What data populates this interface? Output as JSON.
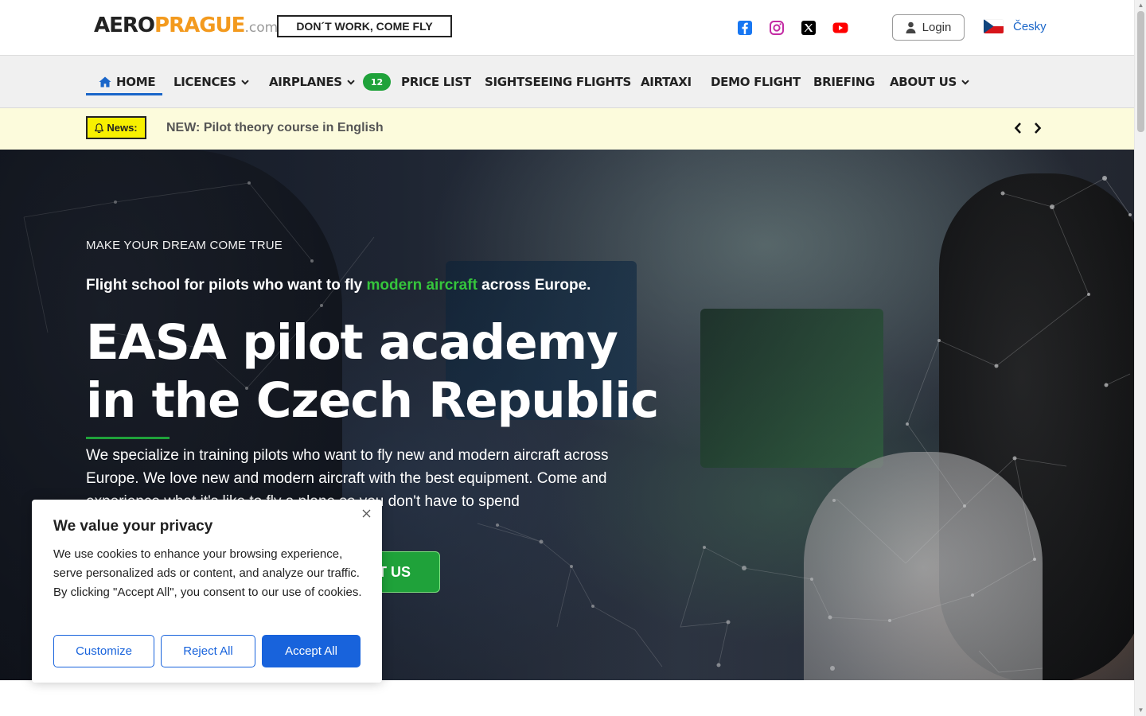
{
  "header": {
    "logo": {
      "part1": "AERO",
      "part2": "PRAGUE",
      "part3": ".com"
    },
    "slogan": "DON´T WORK, COME FLY",
    "social": [
      {
        "name": "facebook",
        "color": "#1877f2"
      },
      {
        "name": "instagram",
        "color": "#c32aa3"
      },
      {
        "name": "x",
        "color": "#000000"
      },
      {
        "name": "youtube",
        "color": "#ff0000"
      }
    ],
    "login_label": "Login",
    "language_label": "Česky"
  },
  "nav": {
    "items": [
      {
        "label": "HOME",
        "active": true
      },
      {
        "label": "LICENCES",
        "dropdown": true
      },
      {
        "label": "AIRPLANES",
        "dropdown": true,
        "badge": "12"
      },
      {
        "label": "PRICE LIST"
      },
      {
        "label": "SIGHTSEEING FLIGHTS"
      },
      {
        "label": "AIRTAXI"
      },
      {
        "label": "DEMO FLIGHT"
      },
      {
        "label": "BRIEFING"
      },
      {
        "label": "ABOUT US",
        "dropdown": true
      }
    ]
  },
  "news": {
    "label": "News:",
    "text": "NEW: Pilot theory course in English"
  },
  "hero": {
    "eyebrow": "MAKE YOUR DREAM COME TRUE",
    "lead_before": "Flight school for pilots who want to fly ",
    "lead_highlight": "modern aircraft",
    "lead_after": " across Europe.",
    "title": "EASA pilot academy in the Czech Republic",
    "description": "We specialize in training pilots who want to fly new and modern aircraft across Europe. We love new and modern aircraft with the best equipment. Come and experience what it's like to fly a plane so you don't have to spend",
    "cta_label": "T US"
  },
  "cookie": {
    "title": "We value your privacy",
    "text": "We use cookies to enhance your browsing experience, serve personalized ads or content, and analyze our traffic. By clicking \"Accept All\", you consent to our use of cookies.",
    "customize": "Customize",
    "reject": "Reject All",
    "accept": "Accept All"
  },
  "colors": {
    "brand_green": "#1fa23a",
    "highlight_green": "#35c53c",
    "link_blue": "#1a66c9",
    "cookie_blue": "#1863dc",
    "logo_orange": "#f39a1e",
    "news_bg": "#fcfbdc",
    "news_label_bg": "#f7f000"
  }
}
